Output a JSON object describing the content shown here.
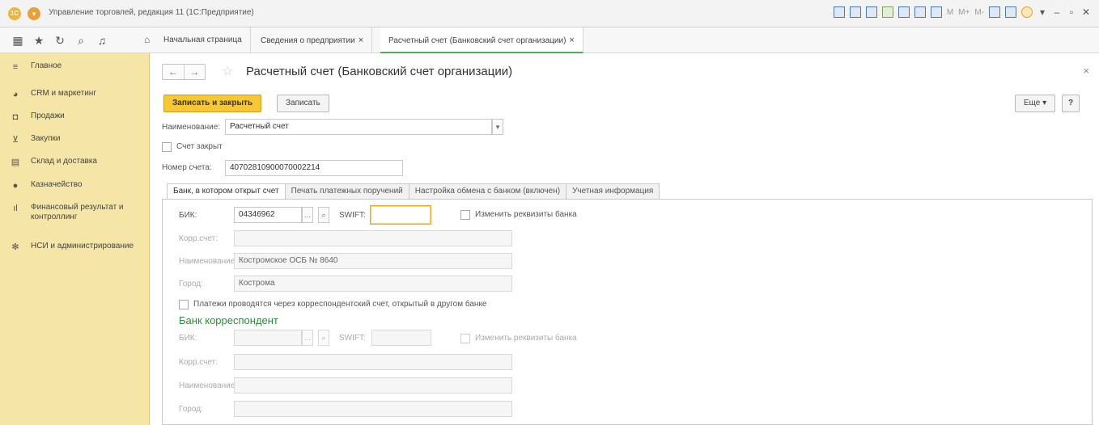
{
  "app": {
    "window_title": "Управление торговлей, редакция 11 (1С:Предприятие)"
  },
  "nav": {
    "tabs": [
      {
        "label": "Начальная страница"
      },
      {
        "label": "Сведения о предприятии",
        "close": "×"
      },
      {
        "label": "Расчетный счет (Банковский счет организации)",
        "close": "×"
      }
    ]
  },
  "sidebar": {
    "items": [
      {
        "label": "Главное",
        "icon": "list-icon"
      },
      {
        "label": "CRM и маркетинг",
        "icon": "pie-chart-icon"
      },
      {
        "label": "Продажи",
        "icon": "shopping-bag-icon"
      },
      {
        "label": "Закупки",
        "icon": "cart-icon"
      },
      {
        "label": "Склад и доставка",
        "icon": "warehouse-icon"
      },
      {
        "label": "Казначейство",
        "icon": "money-icon"
      },
      {
        "label": "Финансовый результат и контроллинг",
        "icon": "bar-chart-icon"
      },
      {
        "label": "НСИ и администрирование",
        "icon": "gear-icon"
      }
    ]
  },
  "form": {
    "title": "Расчетный счет (Банковский счет организации)",
    "close": "×",
    "toolbar": {
      "save_close": "Записать и закрыть",
      "save": "Записать",
      "more": "Еще",
      "help": "?"
    },
    "name_label": "Наименование:",
    "name_value": "Расчетный счет",
    "closed_label": "Счет закрыт",
    "number_label": "Номер счета:",
    "number_value": "40702810900070002214",
    "tabs": [
      "Банк, в котором открыт счет",
      "Печать платежных поручений",
      "Настройка обмена с банком (включен)",
      "Учетная информация"
    ],
    "bank": {
      "bik_label": "БИК:",
      "bik_value": "04346962",
      "swift_label": "SWIFT:",
      "swift_value": "",
      "change_label": "Изменить реквизиты банка",
      "corr_label": "Корр.счет:",
      "corr_value": "",
      "name_label": "Наименование:",
      "name_value": "Костромское ОСБ № 8640",
      "city_label": "Город:",
      "city_value": "Кострома"
    },
    "payments_via_corr": "Платежи проводятся через корреспондентский счет, открытый в другом банке",
    "corr_bank": {
      "title": "Банк корреспондент",
      "bik_label": "БИК:",
      "swift_label": "SWIFT:",
      "change_label": "Изменить реквизиты банка",
      "corr_label": "Корр.счет:",
      "name_label": "Наименование:",
      "city_label": "Город:"
    }
  }
}
